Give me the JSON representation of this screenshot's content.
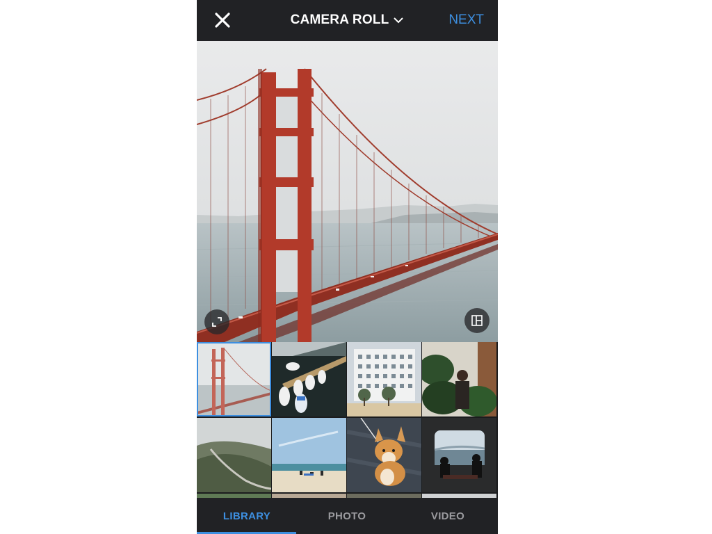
{
  "header": {
    "title": "CAMERA ROLL",
    "next_label": "NEXT",
    "close_icon": "close-icon",
    "dropdown_icon": "chevron-down-icon"
  },
  "preview": {
    "subject": "Golden Gate Bridge",
    "expand_icon": "expand-icon",
    "layout_icon": "layout-icon"
  },
  "library": {
    "thumbnails": [
      {
        "subject": "Golden Gate Bridge",
        "selected": true
      },
      {
        "subject": "Boats in marina"
      },
      {
        "subject": "White building with palm trees"
      },
      {
        "subject": "Man among plants"
      },
      {
        "subject": "Coastal hills with road"
      },
      {
        "subject": "Beach with people"
      },
      {
        "subject": "Corgi on leash"
      },
      {
        "subject": "People at window with sea view"
      }
    ]
  },
  "tabs": [
    {
      "label": "LIBRARY",
      "active": true
    },
    {
      "label": "PHOTO",
      "active": false
    },
    {
      "label": "VIDEO",
      "active": false
    }
  ],
  "colors": {
    "accent": "#3d8fe0",
    "bar_background": "#212225",
    "inactive_tab": "#9a9a9e"
  }
}
